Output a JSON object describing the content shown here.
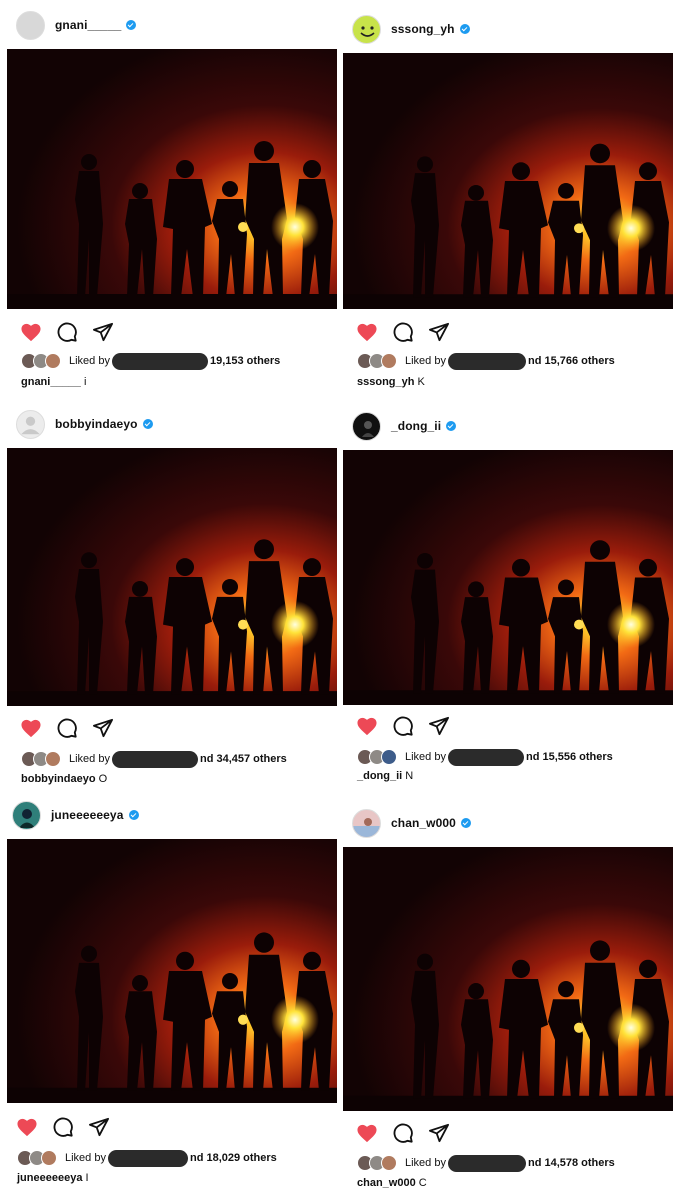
{
  "posts": [
    {
      "username": "gnani_____",
      "avatar_color": "#d8d8d8",
      "liked_prefix": "Liked by",
      "liked_tail": "19,153 others",
      "caption_user": "gnani_____",
      "caption_text": "i"
    },
    {
      "username": "sssong_yh",
      "avatar_color": "#c8e34a",
      "liked_prefix": "Liked by",
      "liked_tail": "nd 15,766 others",
      "caption_user": "sssong_yh",
      "caption_text": "K"
    },
    {
      "username": "bobbyindaeyo",
      "avatar_color": "#e6e6e6",
      "liked_prefix": "Liked by",
      "liked_tail": "nd 34,457 others",
      "caption_user": "bobbyindaeyo",
      "caption_text": "O"
    },
    {
      "username": "_dong_ii",
      "avatar_color": "#101010",
      "liked_prefix": "Liked by",
      "liked_tail": "nd 15,556 others",
      "caption_user": "_dong_ii",
      "caption_text": "N"
    },
    {
      "username": "juneeeeeeya",
      "avatar_color": "#2f7f7a",
      "liked_prefix": "Liked by",
      "liked_tail": "nd 18,029 others",
      "caption_user": "juneeeeeeya",
      "caption_text": "I"
    },
    {
      "username": "chan_w000",
      "avatar_color": "#e8c6c6",
      "liked_prefix": "Liked by",
      "liked_tail": "nd 14,578 others",
      "caption_user": "chan_w000",
      "caption_text": "C"
    }
  ],
  "icons": {
    "like": "heart-icon",
    "comment": "comment-icon",
    "share": "send-icon",
    "verified": "verified-badge-icon"
  },
  "colors": {
    "like_red": "#ed4956",
    "verified_blue": "#1d9bf0"
  }
}
